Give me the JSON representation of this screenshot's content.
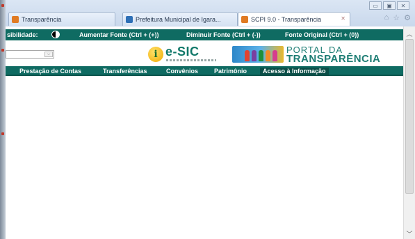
{
  "browser": {
    "tabs": [
      {
        "label": "Transparência",
        "icon_color": "#e07b24",
        "active": false
      },
      {
        "label": "Prefeitura Municipal de Igara...",
        "icon_color": "#2d6fb6",
        "active": false
      },
      {
        "label": "SCPI 9.0 - Transparência",
        "icon_color": "#e07b24",
        "active": true
      }
    ],
    "tab_close": "✕",
    "window_controls": [
      "▭",
      "▣",
      "✕"
    ],
    "toolbar_icons": [
      "⌂",
      "☆",
      "⚙"
    ]
  },
  "accessibility_bar": {
    "contraste_label": "sibilidade:",
    "increase_font": "Aumentar Fonte (Ctrl + (+))",
    "decrease_font": "Diminuir Fonte (Ctrl + (-))",
    "original_font": "Fonte Original (Ctrl + (0))"
  },
  "header": {
    "select_arrow": "⌵",
    "esic_badge": "i",
    "esic_text": "e-SIC",
    "portal_line1": "PORTAL DA",
    "portal_line2": "TRANSPARÊNCIA"
  },
  "nav": {
    "items": [
      {
        "label": "Prestação de Contas"
      },
      {
        "label": "Transferências"
      },
      {
        "label": "Convênios"
      },
      {
        "label": "Patrimônio"
      },
      {
        "label": "Acesso à Informação",
        "active": true
      }
    ]
  },
  "scrollbar": {
    "up": "︿",
    "down": "﹀"
  },
  "colors": {
    "brand_green": "#0f6b62",
    "portal_text": "#1d7d74"
  }
}
